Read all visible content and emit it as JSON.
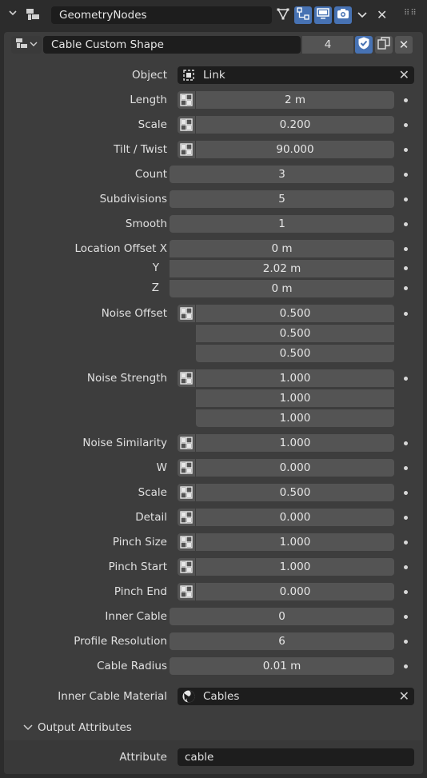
{
  "header": {
    "modifier_name": "GeometryNodes",
    "close_symbol": "✕",
    "grip_symbol": "⠿⠿"
  },
  "node_group": {
    "name": "Cable Custom Shape",
    "users": "4",
    "close_symbol": "✕"
  },
  "inputs": {
    "object": {
      "label": "Object",
      "value": "Link"
    },
    "length": {
      "label": "Length",
      "value": "2 m"
    },
    "scale": {
      "label": "Scale",
      "value": "0.200"
    },
    "tilt": {
      "label": "Tilt / Twist",
      "value": "90.000"
    },
    "count": {
      "label": "Count",
      "value": "3"
    },
    "subdivisions": {
      "label": "Subdivisions",
      "value": "5"
    },
    "smooth": {
      "label": "Smooth",
      "value": "1"
    },
    "location_offset": {
      "label_x": "Location Offset X",
      "label_y": "Y",
      "label_z": "Z",
      "x": "0 m",
      "y": "2.02 m",
      "z": "0 m"
    },
    "noise_offset": {
      "label": "Noise Offset",
      "values": [
        "0.500",
        "0.500",
        "0.500"
      ]
    },
    "noise_strength": {
      "label": "Noise Strength",
      "values": [
        "1.000",
        "1.000",
        "1.000"
      ]
    },
    "noise_similarity": {
      "label": "Noise Similarity",
      "value": "1.000"
    },
    "w": {
      "label": "W",
      "value": "0.000"
    },
    "noise_scale": {
      "label": "Scale",
      "value": "0.500"
    },
    "detail": {
      "label": "Detail",
      "value": "0.000"
    },
    "pinch_size": {
      "label": "Pinch Size",
      "value": "1.000"
    },
    "pinch_start": {
      "label": "Pinch Start",
      "value": "1.000"
    },
    "pinch_end": {
      "label": "Pinch End",
      "value": "0.000"
    },
    "inner_cable": {
      "label": "Inner Cable",
      "value": "0"
    },
    "profile_resolution": {
      "label": "Profile Resolution",
      "value": "6"
    },
    "cable_radius": {
      "label": "Cable Radius",
      "value": "0.01 m"
    },
    "inner_cable_material": {
      "label": "Inner Cable Material",
      "value": "Cables"
    }
  },
  "output_attributes": {
    "title": "Output Attributes",
    "attribute_label": "Attribute",
    "attribute_value": "cable"
  },
  "colors": {
    "accent": "#4772b3",
    "panel": "#3d3d3d",
    "field": "#545454",
    "dark_field": "#1d1d1d"
  }
}
